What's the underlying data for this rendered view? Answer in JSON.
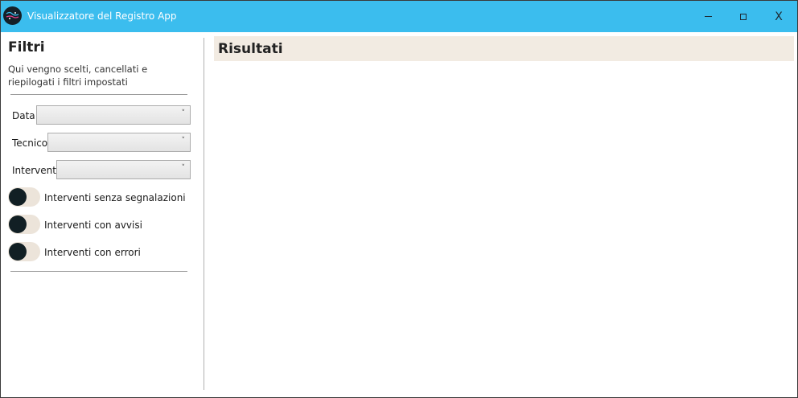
{
  "window": {
    "title": "Visualizzatore del Registro App",
    "titlebar_color": "#3bbdee",
    "icon": "app-logo-icon",
    "controls": {
      "minimize": "minimize-icon",
      "maximize": "maximize-icon",
      "close_label": "X"
    }
  },
  "filters": {
    "title": "Filtri",
    "description": "Qui vengno scelti, cancellati e riepilogati i filtri impostati",
    "fields": [
      {
        "label": "Data",
        "value": ""
      },
      {
        "label": "Tecnico",
        "value": ""
      },
      {
        "label": "Interventi",
        "value": ""
      }
    ],
    "toggles": [
      {
        "label": "Interventi senza segnalazioni",
        "on": false
      },
      {
        "label": "Interventi con avvisi",
        "on": false
      },
      {
        "label": "Interventi con errori",
        "on": false
      }
    ],
    "chevron": "chevron-down-icon"
  },
  "results": {
    "title": "Risultati",
    "header_color": "#f2ebe2"
  }
}
